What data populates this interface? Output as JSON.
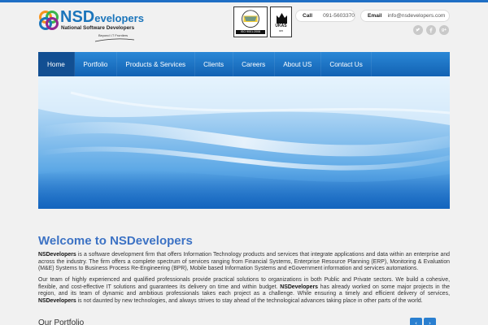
{
  "brand": {
    "logo_prefix": "NSD",
    "logo_rest": "evelopers",
    "subtitle": "National Software Developers",
    "tagline": "Beyond I.T Frontiers"
  },
  "certs": {
    "iso_label": "ISO 9001:2008",
    "ukas_label": "UKAS",
    "ukas_code": "005"
  },
  "contact": {
    "call_label": "Call",
    "call_value": "091-5603370",
    "email_label": "Email",
    "email_value": "info@nsdevelopers.com"
  },
  "social": {
    "twitter": "twitter-icon",
    "facebook": "facebook-icon",
    "googleplus": "google-plus-icon",
    "gplus_glyph": "g+"
  },
  "nav": {
    "items": [
      {
        "label": "Home",
        "active": true
      },
      {
        "label": "Portfolio"
      },
      {
        "label": "Products & Services"
      },
      {
        "label": "Clients"
      },
      {
        "label": "Careers"
      },
      {
        "label": "About US"
      },
      {
        "label": "Contact Us"
      }
    ]
  },
  "welcome": {
    "title": "Welcome to NSDevelopers",
    "p1_brand": "NSDevelopers",
    "p1_text": " is a software development firm that offers Information Technology products and services that integrate applications and data within an enterprise and across the industry. The firm offers a complete spectrum of services ranging from Financial Systems, Enterprise Resource Planning (ERP), Monitoring & Evaluation (M&E) Systems to Business Process Re-Engineering (BPR), Mobile based Information Systems and eGovernment information and services automations.",
    "p2_a": "Our team of highly experienced and qualified professionals provide practical solutions to organizations in both Public and Private sectors. We build a cohesive, flexible, and cost-effective IT solutions and guarantees its delivery on time and within budget. ",
    "p2_brand1": "NSDevelopers",
    "p2_b": " has already worked on some major projects in the region, and its team of dynamic and ambitious professionals takes each project as a challenge. While ensuring a timely and efficient delivery of services, ",
    "p2_brand2": "NSDevelopers",
    "p2_c": " is not daunted by new technologies, and always strives to stay ahead of the technological advances taking place in other parts of the world."
  },
  "portfolio": {
    "title": "Our Portfolio",
    "prev": "‹",
    "next": "›"
  },
  "colors": {
    "accent": "#1f6fc5",
    "nav_active": "#124f92",
    "title": "#3c72c4"
  }
}
